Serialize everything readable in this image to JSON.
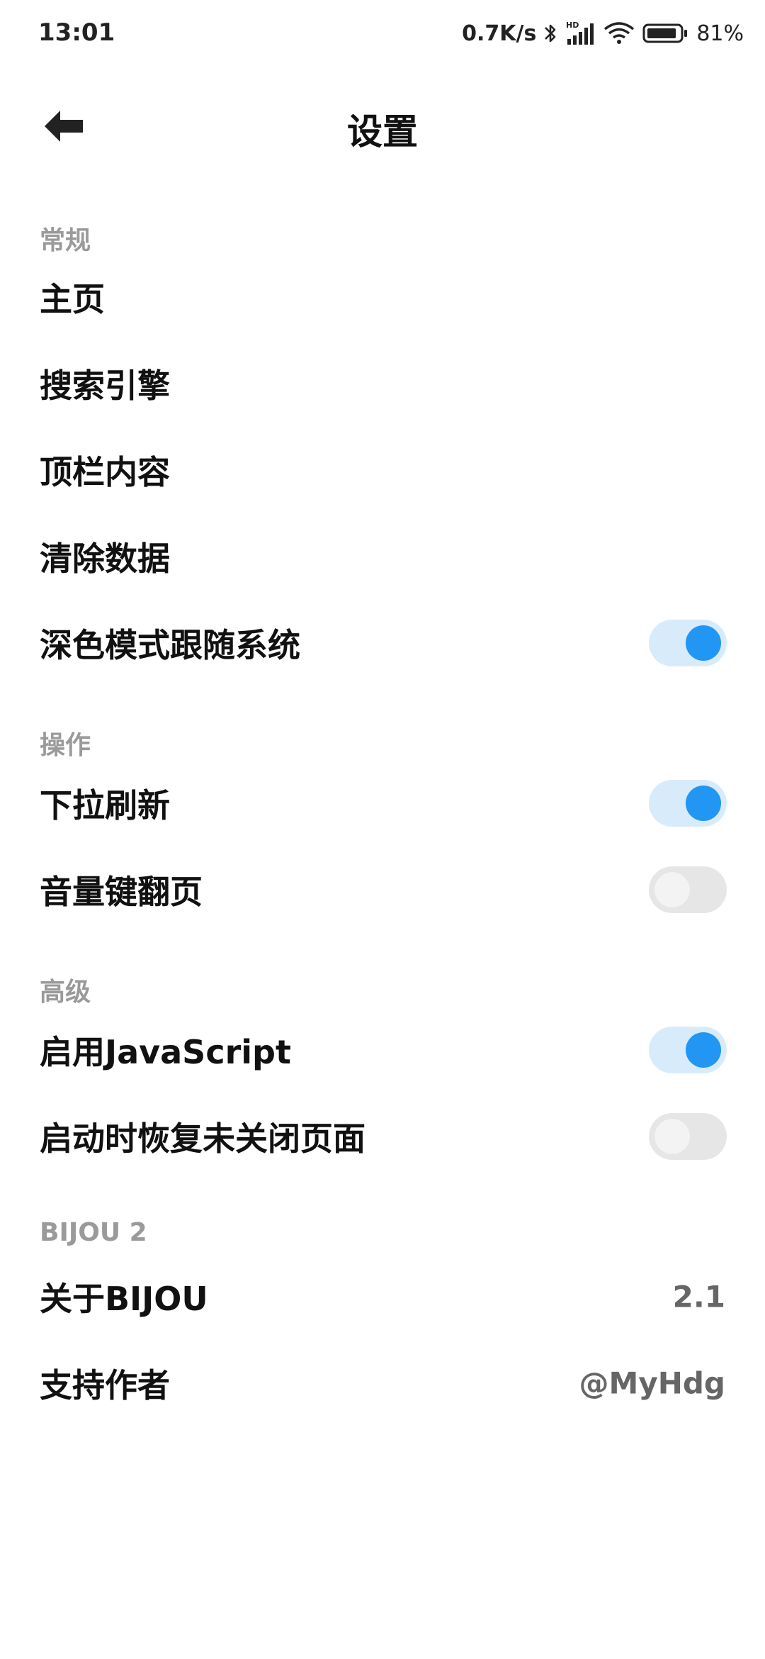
{
  "status_bar": {
    "time": "13:01",
    "net_speed": "0.7K/s",
    "battery_pct": "81%",
    "icons": [
      "bluetooth-icon",
      "hd-signal-icon",
      "wifi-icon",
      "battery-icon"
    ]
  },
  "app_bar": {
    "title": "设置",
    "back_icon": "back-arrow-icon"
  },
  "sections": {
    "general": {
      "header": "常规",
      "items": [
        {
          "label": "主页"
        },
        {
          "label": "搜索引擎"
        },
        {
          "label": "顶栏内容"
        },
        {
          "label": "清除数据"
        },
        {
          "label": "深色模式跟随系统",
          "toggle": true
        }
      ]
    },
    "operation": {
      "header": "操作",
      "items": [
        {
          "label": "下拉刷新",
          "toggle": true
        },
        {
          "label": "音量键翻页",
          "toggle": false
        }
      ]
    },
    "advanced": {
      "header": "高级",
      "items": [
        {
          "label": "启用JavaScript",
          "toggle": true
        },
        {
          "label": "启动时恢复未关闭页面",
          "toggle": false
        }
      ]
    },
    "about": {
      "header": "BIJOU 2",
      "items": [
        {
          "label": "关于BIJOU",
          "value": "2.1"
        },
        {
          "label": "支持作者",
          "value": "@MyHdg"
        }
      ]
    }
  },
  "colors": {
    "accent": "#2196f3",
    "toggle_track_on": "#d8ebfb",
    "toggle_track_off": "#e6e6e6",
    "section_header": "#9a9a9a"
  }
}
